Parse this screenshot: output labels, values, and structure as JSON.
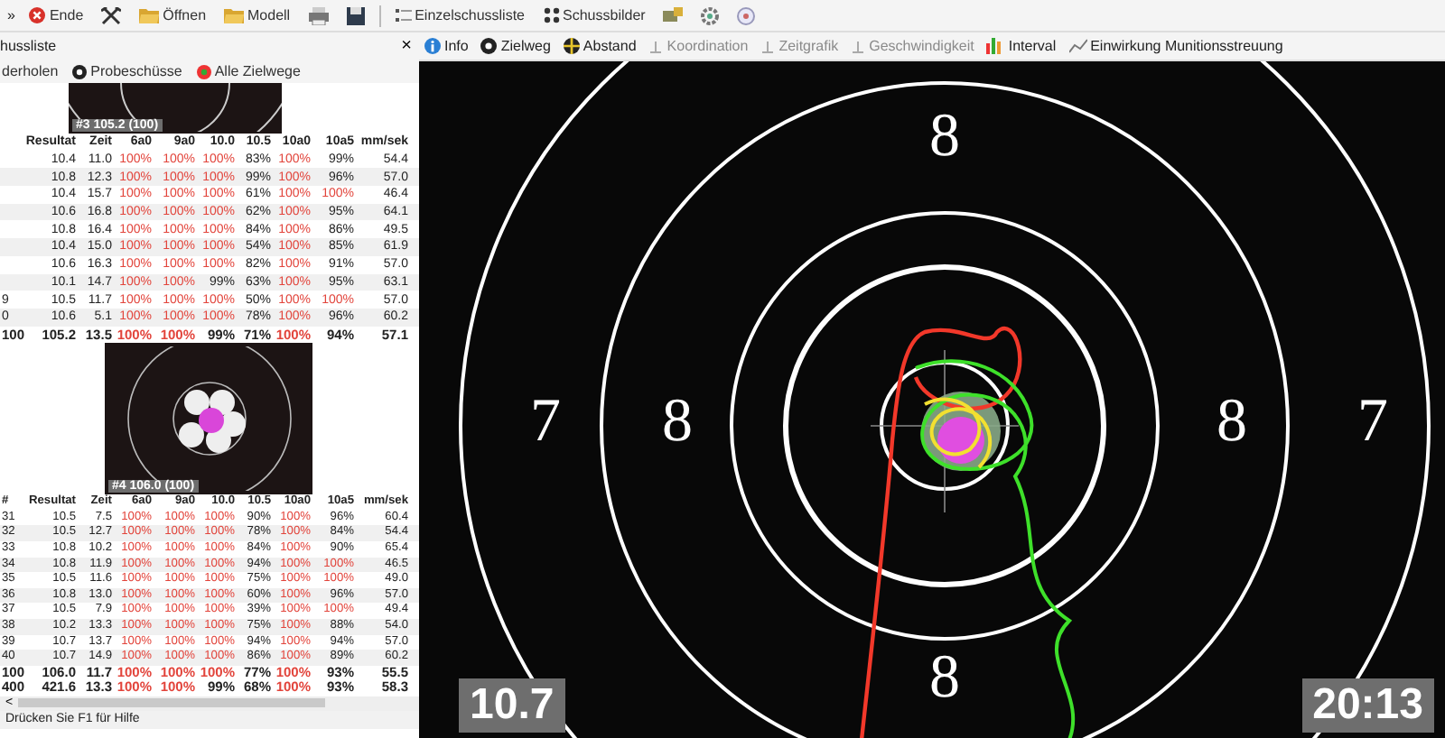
{
  "toolbar": {
    "overflow": "»",
    "items": [
      {
        "kind": "labeled",
        "label": "Ende"
      },
      {
        "kind": "icon"
      },
      {
        "kind": "labeled",
        "label": "Öffnen"
      },
      {
        "kind": "labeled",
        "label": "Modell"
      },
      {
        "kind": "icon"
      },
      {
        "kind": "icon"
      },
      {
        "kind": "labeled",
        "label": "Einzelschussliste"
      },
      {
        "kind": "labeled",
        "label": "Schussbilder"
      },
      {
        "kind": "icon"
      },
      {
        "kind": "icon"
      },
      {
        "kind": "icon"
      }
    ]
  },
  "panel": {
    "title": "hussliste",
    "close": "×",
    "tabs": [
      {
        "label": "derholen",
        "selected": false
      },
      {
        "label": "Probeschüsse",
        "selected": false
      },
      {
        "label": "Alle Zielwege",
        "selected": false
      }
    ],
    "thumbnail_top": {
      "label": "#3 105.2 (100)"
    },
    "table_top": {
      "columns": [
        "Resultat",
        "Zeit",
        "6a0",
        "9a0",
        "10.0",
        "10.5",
        "10a0",
        "10a5",
        "mm/sek"
      ],
      "rows": [
        {
          "kind": "shot",
          "cells": [
            "10.4",
            "11.0",
            "100%",
            "100%",
            "100%",
            "83%",
            "100%",
            "99%",
            "54.4"
          ],
          "full": [
            false,
            false,
            true,
            true,
            true,
            false,
            true,
            false,
            false
          ]
        },
        {
          "kind": "shot",
          "cells": [
            "10.8",
            "12.3",
            "100%",
            "100%",
            "100%",
            "99%",
            "100%",
            "96%",
            "57.0"
          ],
          "full": [
            false,
            false,
            true,
            true,
            true,
            false,
            true,
            false,
            false
          ]
        },
        {
          "kind": "shot",
          "cells": [
            "10.4",
            "15.7",
            "100%",
            "100%",
            "100%",
            "61%",
            "100%",
            "100%",
            "46.4"
          ],
          "full": [
            false,
            false,
            true,
            true,
            true,
            false,
            true,
            true,
            false
          ]
        },
        {
          "kind": "shot",
          "cells": [
            "10.6",
            "16.8",
            "100%",
            "100%",
            "100%",
            "62%",
            "100%",
            "95%",
            "64.1"
          ],
          "full": [
            false,
            false,
            true,
            true,
            true,
            false,
            true,
            false,
            false
          ]
        },
        {
          "kind": "shot",
          "cells": [
            "10.8",
            "16.4",
            "100%",
            "100%",
            "100%",
            "84%",
            "100%",
            "86%",
            "49.5"
          ],
          "full": [
            false,
            false,
            true,
            true,
            true,
            false,
            true,
            false,
            false
          ]
        },
        {
          "kind": "shot",
          "cells": [
            "10.4",
            "15.0",
            "100%",
            "100%",
            "100%",
            "54%",
            "100%",
            "85%",
            "61.9"
          ],
          "full": [
            false,
            false,
            true,
            true,
            true,
            false,
            true,
            false,
            false
          ]
        },
        {
          "kind": "shot",
          "cells": [
            "10.6",
            "16.3",
            "100%",
            "100%",
            "100%",
            "82%",
            "100%",
            "91%",
            "57.0"
          ],
          "full": [
            false,
            false,
            true,
            true,
            true,
            false,
            true,
            false,
            false
          ]
        },
        {
          "kind": "shot",
          "cells": [
            "10.1",
            "14.7",
            "100%",
            "100%",
            "99%",
            "63%",
            "100%",
            "95%",
            "63.1"
          ],
          "full": [
            false,
            false,
            true,
            true,
            false,
            false,
            true,
            false,
            false
          ]
        },
        {
          "kind": "shot",
          "num": "9",
          "cells": [
            "10.5",
            "11.7",
            "100%",
            "100%",
            "100%",
            "50%",
            "100%",
            "100%",
            "57.0"
          ],
          "full": [
            false,
            false,
            true,
            true,
            true,
            false,
            true,
            true,
            false
          ]
        },
        {
          "kind": "shot",
          "num": "0",
          "cells": [
            "10.6",
            "5.1",
            "100%",
            "100%",
            "100%",
            "78%",
            "100%",
            "96%",
            "60.2"
          ],
          "full": [
            false,
            false,
            true,
            true,
            true,
            false,
            true,
            false,
            false
          ]
        },
        {
          "kind": "total",
          "num": "100",
          "cells": [
            "105.2",
            "13.5",
            "100%",
            "100%",
            "99%",
            "71%",
            "100%",
            "94%",
            "57.1"
          ],
          "full": [
            false,
            false,
            true,
            true,
            false,
            false,
            true,
            false,
            false
          ]
        }
      ]
    },
    "thumbnail_bottom": {
      "label": "#4 106.0 (100)"
    },
    "table_bottom": {
      "number_header": "#",
      "columns": [
        "Resultat",
        "Zeit",
        "6a0",
        "9a0",
        "10.0",
        "10.5",
        "10a0",
        "10a5",
        "mm/sek"
      ],
      "rows": [
        {
          "kind": "shot",
          "num": "31",
          "cells": [
            "10.5",
            "7.5",
            "100%",
            "100%",
            "100%",
            "90%",
            "100%",
            "96%",
            "60.4"
          ],
          "full": [
            false,
            false,
            true,
            true,
            true,
            false,
            true,
            false,
            false
          ]
        },
        {
          "kind": "shot",
          "num": "32",
          "cells": [
            "10.5",
            "12.7",
            "100%",
            "100%",
            "100%",
            "78%",
            "100%",
            "84%",
            "54.4"
          ],
          "full": [
            false,
            false,
            true,
            true,
            true,
            false,
            true,
            false,
            false
          ]
        },
        {
          "kind": "shot",
          "num": "33",
          "cells": [
            "10.8",
            "10.2",
            "100%",
            "100%",
            "100%",
            "84%",
            "100%",
            "90%",
            "65.4"
          ],
          "full": [
            false,
            false,
            true,
            true,
            true,
            false,
            true,
            false,
            false
          ]
        },
        {
          "kind": "shot",
          "num": "34",
          "cells": [
            "10.8",
            "11.9",
            "100%",
            "100%",
            "100%",
            "94%",
            "100%",
            "100%",
            "46.5"
          ],
          "full": [
            false,
            false,
            true,
            true,
            true,
            false,
            true,
            true,
            false
          ]
        },
        {
          "kind": "shot",
          "num": "35",
          "cells": [
            "10.5",
            "11.6",
            "100%",
            "100%",
            "100%",
            "75%",
            "100%",
            "100%",
            "49.0"
          ],
          "full": [
            false,
            false,
            true,
            true,
            true,
            false,
            true,
            true,
            false
          ]
        },
        {
          "kind": "shot",
          "num": "36",
          "cells": [
            "10.8",
            "13.0",
            "100%",
            "100%",
            "100%",
            "60%",
            "100%",
            "96%",
            "57.0"
          ],
          "full": [
            false,
            false,
            true,
            true,
            true,
            false,
            true,
            false,
            false
          ]
        },
        {
          "kind": "shot",
          "num": "37",
          "cells": [
            "10.5",
            "7.9",
            "100%",
            "100%",
            "100%",
            "39%",
            "100%",
            "100%",
            "49.4"
          ],
          "full": [
            false,
            false,
            true,
            true,
            true,
            false,
            true,
            true,
            false
          ]
        },
        {
          "kind": "shot",
          "num": "38",
          "cells": [
            "10.2",
            "13.3",
            "100%",
            "100%",
            "100%",
            "75%",
            "100%",
            "88%",
            "54.0"
          ],
          "full": [
            false,
            false,
            true,
            true,
            true,
            false,
            true,
            false,
            false
          ]
        },
        {
          "kind": "shot",
          "num": "39",
          "cells": [
            "10.7",
            "13.7",
            "100%",
            "100%",
            "100%",
            "94%",
            "100%",
            "94%",
            "57.0"
          ],
          "full": [
            false,
            false,
            true,
            true,
            true,
            false,
            true,
            false,
            false
          ]
        },
        {
          "kind": "shot",
          "num": "40",
          "cells": [
            "10.7",
            "14.9",
            "100%",
            "100%",
            "100%",
            "86%",
            "100%",
            "89%",
            "60.2"
          ],
          "full": [
            false,
            false,
            true,
            true,
            true,
            false,
            true,
            false,
            false
          ]
        },
        {
          "kind": "total",
          "num": "100",
          "cells": [
            "106.0",
            "11.7",
            "100%",
            "100%",
            "100%",
            "77%",
            "100%",
            "93%",
            "55.5"
          ],
          "full": [
            false,
            false,
            true,
            true,
            true,
            false,
            true,
            false,
            false
          ]
        },
        {
          "kind": "total",
          "num": "400",
          "cells": [
            "421.6",
            "13.3",
            "100%",
            "100%",
            "99%",
            "68%",
            "100%",
            "93%",
            "58.3"
          ],
          "full": [
            false,
            false,
            true,
            true,
            false,
            false,
            true,
            false,
            false
          ]
        }
      ]
    },
    "scroll_left": "<"
  },
  "status_bar": "Drücken Sie F1 für Hilfe",
  "target_toolbar": [
    {
      "label": "Info",
      "disabled": false
    },
    {
      "label": "Zielweg",
      "disabled": false
    },
    {
      "label": "Abstand",
      "disabled": false
    },
    {
      "label": "Koordination",
      "disabled": true
    },
    {
      "label": "Zeitgrafik",
      "disabled": true
    },
    {
      "label": "Geschwindigkeit",
      "disabled": true
    },
    {
      "label": "Interval",
      "disabled": false
    },
    {
      "label": "Einwirkung Munitionsstreuung",
      "disabled": false
    }
  ],
  "target": {
    "ring_numbers": [
      "8",
      "7",
      "8",
      "8",
      "7",
      "8"
    ],
    "score": "10.7",
    "time": "20:13"
  }
}
